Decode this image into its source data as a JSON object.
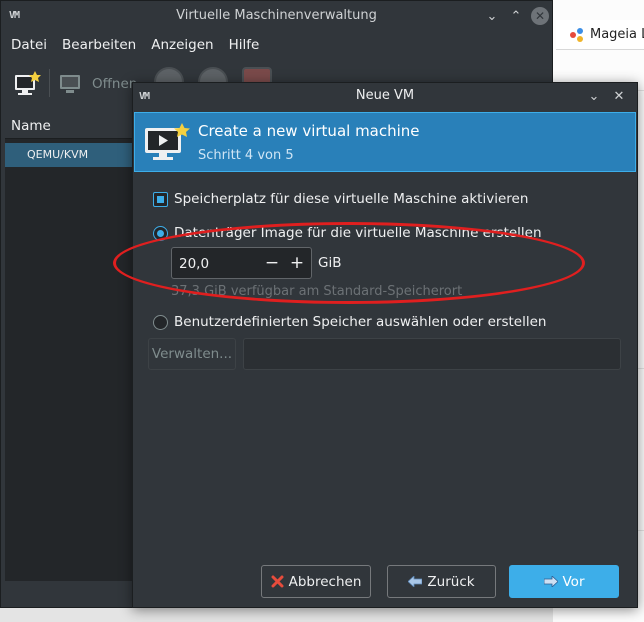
{
  "main_window": {
    "title": "Virtuelle Maschinenverwaltung",
    "menu": [
      "Datei",
      "Bearbeiten",
      "Anzeigen",
      "Hilfe"
    ],
    "toolbar": {
      "open_label": "Offnen"
    },
    "list": {
      "header": "Name",
      "rows": [
        "QEMU/KVM"
      ]
    }
  },
  "background": {
    "tab_label": "Mageia L"
  },
  "dialog": {
    "title": "Neue VM",
    "header_title": "Create a new virtual machine",
    "header_subtitle": "Schritt 4 von 5",
    "enable_storage_label": "Speicherplatz für diese virtuelle Maschine aktivieren",
    "create_image_label": "Datenträger Image für die virtuelle Maschine erstellen",
    "size_value": "20,0",
    "size_unit": "GiB",
    "available_text": "37,3 GiB verfügbar am Standard-Speicherort",
    "custom_storage_label": "Benutzerdefinierten Speicher auswählen oder erstellen",
    "manage_button": "Verwalten...",
    "cancel_button": "Abbrechen",
    "back_button": "Zurück",
    "next_button": "Vor",
    "minus_glyph": "−",
    "plus_glyph": "+"
  },
  "colors": {
    "accent": "#3daee9",
    "header_bg": "#2980b9",
    "window_bg": "#31363b",
    "annotation": "#e01f1f"
  },
  "icons": [
    "vm-logo-icon",
    "monitor-star-icon",
    "monitor-icon",
    "play-icon",
    "pause-icon",
    "stop-icon",
    "x-mark-icon",
    "arrow-left-icon",
    "arrow-right-icon",
    "chevron-down-icon",
    "close-icon",
    "minimize-icon",
    "maximize-icon"
  ]
}
